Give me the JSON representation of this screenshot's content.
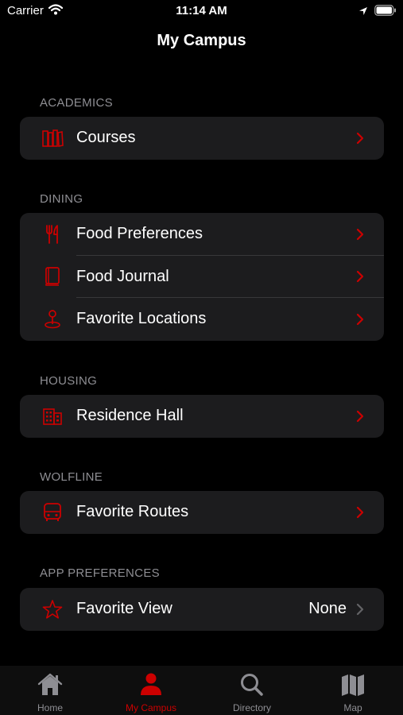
{
  "status_bar": {
    "carrier": "Carrier",
    "time": "11:14 AM"
  },
  "nav": {
    "title": "My Campus"
  },
  "colors": {
    "accent": "#cc0000",
    "background": "#000000",
    "cell": "#1c1c1e",
    "secondary_text": "#8e8e93"
  },
  "sections": {
    "academics": {
      "header": "ACADEMICS",
      "items": [
        {
          "label": "Courses",
          "icon": "books-icon"
        }
      ]
    },
    "dining": {
      "header": "DINING",
      "items": [
        {
          "label": "Food Preferences",
          "icon": "fork-knife-icon"
        },
        {
          "label": "Food Journal",
          "icon": "journal-icon"
        },
        {
          "label": "Favorite Locations",
          "icon": "map-pin-icon"
        }
      ]
    },
    "housing": {
      "header": "HOUSING",
      "items": [
        {
          "label": "Residence Hall",
          "icon": "building-icon"
        }
      ]
    },
    "wolfline": {
      "header": "WOLFLINE",
      "items": [
        {
          "label": "Favorite Routes",
          "icon": "bus-icon"
        }
      ]
    },
    "app_preferences": {
      "header": "APP PREFERENCES",
      "items": [
        {
          "label": "Favorite View",
          "value": "None",
          "icon": "star-icon"
        }
      ]
    }
  },
  "tab_bar": {
    "tabs": [
      {
        "label": "Home",
        "icon": "house-icon"
      },
      {
        "label": "My Campus",
        "icon": "person-icon",
        "active": true
      },
      {
        "label": "Directory",
        "icon": "magnifier-icon"
      },
      {
        "label": "Map",
        "icon": "map-icon"
      }
    ]
  }
}
